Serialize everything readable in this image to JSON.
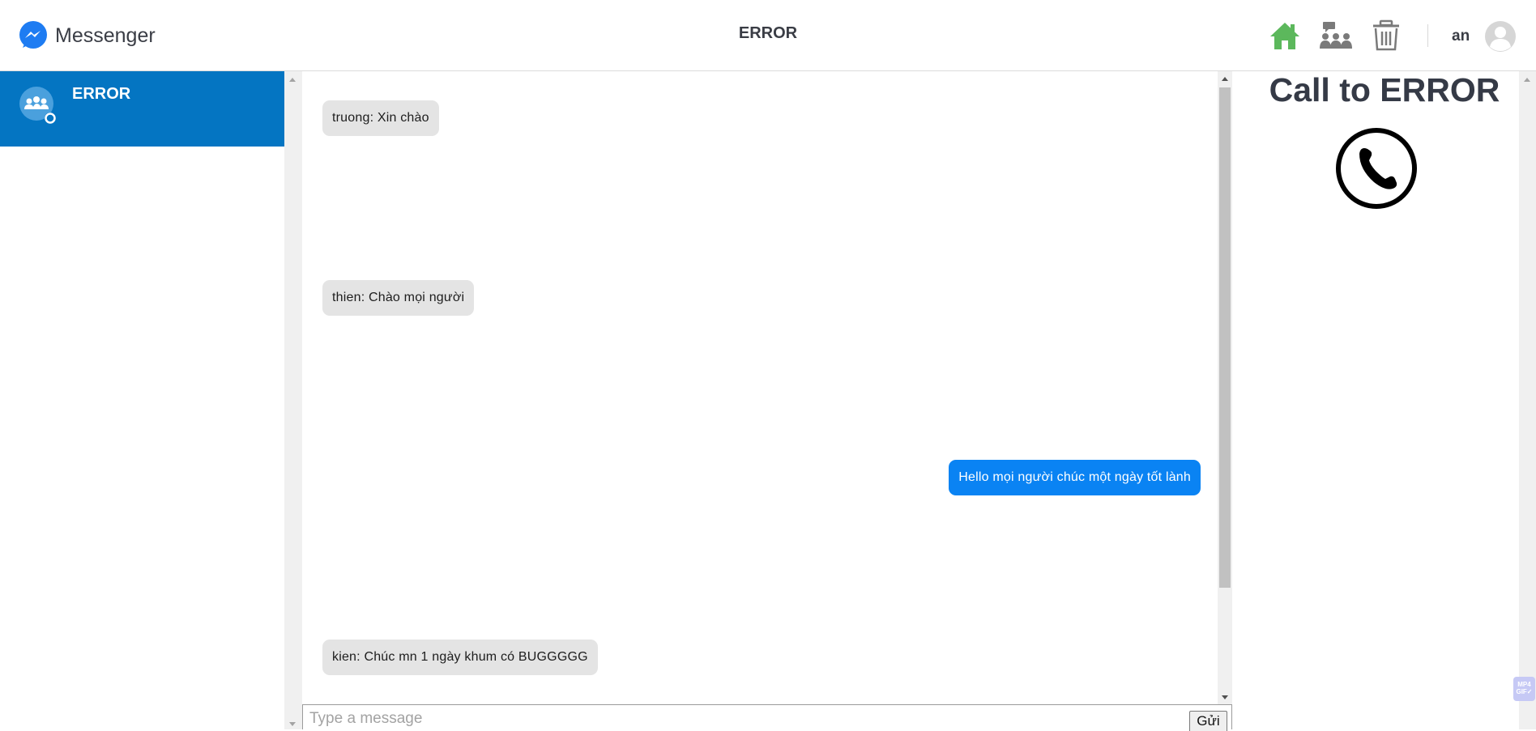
{
  "header": {
    "brand_name": "Messenger",
    "title": "ERROR",
    "icons": [
      "home-icon",
      "group-chat-icon",
      "trash-icon"
    ],
    "username": "an",
    "colors": {
      "home": "#5cb85c",
      "icons": "#777777"
    }
  },
  "sidebar": {
    "conversations": [
      {
        "name": "ERROR",
        "icon": "group-icon",
        "active": true
      }
    ],
    "active_color": "#0475c2"
  },
  "chat": {
    "messages": [
      {
        "text": "truong: Xin chào",
        "direction": "in"
      },
      {
        "text": "thien: Chào mọi người",
        "direction": "in"
      },
      {
        "text": "Hello mọi người chúc một ngày tốt lành",
        "direction": "out"
      },
      {
        "text": "kien: Chúc mn 1 ngày khum có BUGGGGG",
        "direction": "in"
      }
    ],
    "incoming_color": "#e4e4e4",
    "outgoing_color": "#0a83f3"
  },
  "composer": {
    "placeholder": "Type a message",
    "value": "",
    "send_label": "Gửi"
  },
  "call": {
    "title": "Call to ERROR",
    "icon": "phone-icon"
  },
  "extension_badge": {
    "line1": "MP4",
    "line2": "GIF✓"
  }
}
